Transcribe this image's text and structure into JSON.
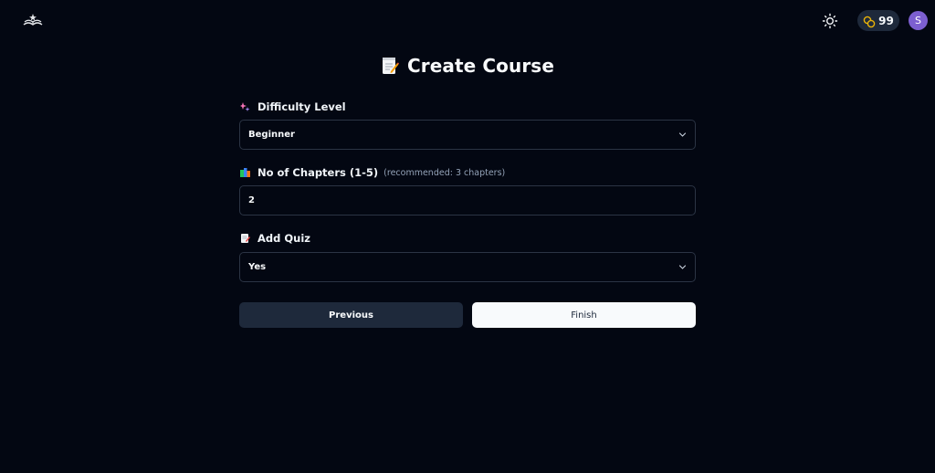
{
  "header": {
    "logo_icon": "open-book-icon",
    "theme_icon": "sun-icon",
    "credits_icon": "coins-icon",
    "credits": "99",
    "avatar_initial": "S"
  },
  "page": {
    "title_icon": "memo-icon",
    "title": "Create Course"
  },
  "form": {
    "difficulty": {
      "icon": "sparkles-icon",
      "label": "Difficulty Level",
      "value": "Beginner"
    },
    "chapters": {
      "icon": "books-icon",
      "label": "No of Chapters (1-5)",
      "hint": "(recommended: 3 chapters)",
      "value": "2"
    },
    "quiz": {
      "icon": "memo-icon",
      "label": "Add Quiz",
      "value": "Yes"
    }
  },
  "actions": {
    "previous_label": "Previous",
    "finish_label": "Finish"
  },
  "colors": {
    "background": "#030712",
    "field_border": "#2b3444",
    "secondary_button": "#1e293b",
    "primary_button": "#f8fafc",
    "avatar": "#7c5fd0",
    "coin": "#eab308"
  }
}
